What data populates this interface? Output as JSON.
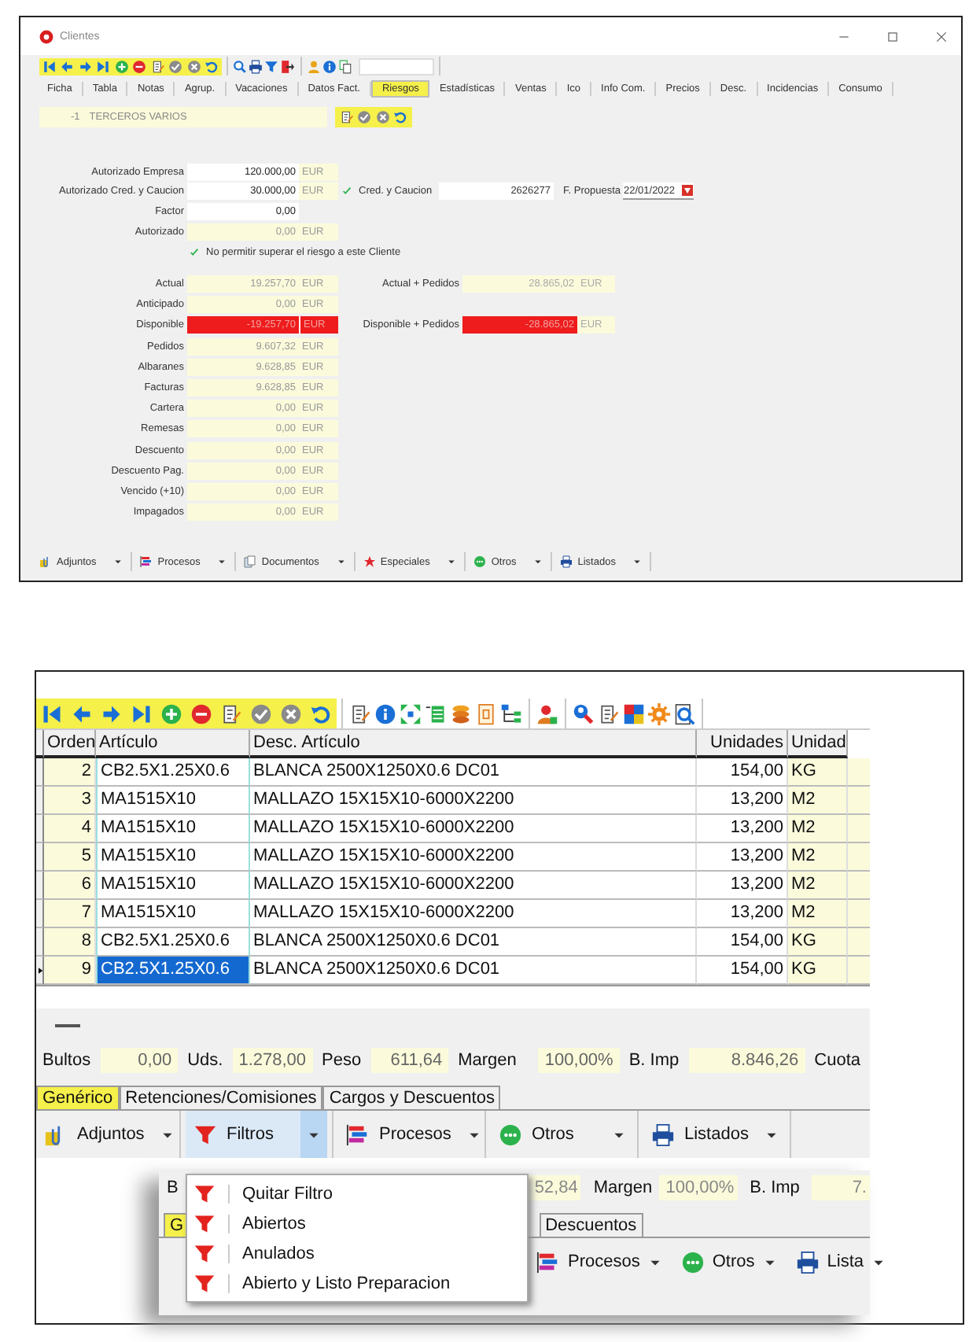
{
  "window": {
    "title": "Clientes"
  },
  "tabs": [
    {
      "label": "Ficha",
      "selected": false
    },
    {
      "label": "Tabla",
      "selected": false
    },
    {
      "label": "Notas",
      "selected": false
    },
    {
      "label": "Agrup.",
      "selected": false
    },
    {
      "label": "Vacaciones",
      "selected": false
    },
    {
      "label": "Datos Fact.",
      "selected": false
    },
    {
      "label": "Riesgos",
      "selected": true
    },
    {
      "label": "Estadísticas",
      "selected": false
    },
    {
      "label": "Ventas",
      "selected": false
    },
    {
      "label": "Ico",
      "selected": false
    },
    {
      "label": "Info Com.",
      "selected": false
    },
    {
      "label": "Precios",
      "selected": false
    },
    {
      "label": "Desc.",
      "selected": false
    },
    {
      "label": "Incidencias",
      "selected": false
    },
    {
      "label": "Consumo",
      "selected": false
    }
  ],
  "customer": {
    "code": "-1",
    "name": "TERCEROS VARIOS"
  },
  "limits": [
    {
      "label": "Autorizado Empresa",
      "value": "120.000,00",
      "unit": "EUR",
      "kind": "editable"
    },
    {
      "label": "Autorizado Cred. y Caucion",
      "value": "30.000,00",
      "unit": "EUR",
      "kind": "editable"
    },
    {
      "label": "Factor",
      "value": "0,00",
      "kind": "editable"
    },
    {
      "label": "Autorizado",
      "value": "0,00",
      "unit": "EUR",
      "kind": "readonly"
    }
  ],
  "credit_insurance": {
    "label": "Cred. y Caucion",
    "checked": true,
    "value": "2626277",
    "date_label": "F. Propuesta",
    "date": "22/01/2022"
  },
  "no_exceed": {
    "label": "No permitir superar el riesgo a este Cliente",
    "checked": true
  },
  "balances": [
    {
      "label": "Actual",
      "value": "19.257,70",
      "unit": "EUR",
      "kind": "readonly"
    },
    {
      "label": "Anticipado",
      "value": "0,00",
      "unit": "EUR",
      "kind": "readonly"
    },
    {
      "label": "Disponible",
      "value": "-19.257,70",
      "unit": "EUR",
      "kind": "alert"
    },
    {
      "label": "Pedidos",
      "value": "9.607,32",
      "unit": "EUR",
      "kind": "readonly"
    },
    {
      "label": "Albaranes",
      "value": "9.628,85",
      "unit": "EUR",
      "kind": "readonly"
    },
    {
      "label": "Facturas",
      "value": "9.628,85",
      "unit": "EUR",
      "kind": "readonly"
    },
    {
      "label": "Cartera",
      "value": "0,00",
      "unit": "EUR",
      "kind": "readonly"
    },
    {
      "label": "Remesas",
      "value": "0,00",
      "unit": "EUR",
      "kind": "readonly"
    },
    {
      "label": "Descuento",
      "value": "0,00",
      "unit": "EUR",
      "kind": "readonly"
    },
    {
      "label": "Descuento Pag.",
      "value": "0,00",
      "unit": "EUR",
      "kind": "readonly"
    },
    {
      "label": "Vencido (+10)",
      "value": "0,00",
      "unit": "EUR",
      "kind": "readonly"
    },
    {
      "label": "Impagados",
      "value": "0,00",
      "unit": "EUR",
      "kind": "readonly"
    }
  ],
  "balances_right": [
    {
      "label": "Actual + Pedidos",
      "value": "28.865,02",
      "unit": "EUR",
      "kind": "readonly"
    },
    {
      "label": "Disponible + Pedidos",
      "value": "-28.865,02",
      "unit": "EUR",
      "kind": "alert"
    }
  ],
  "window_actions": [
    {
      "label": "Adjuntos",
      "kind": "attachment"
    },
    {
      "label": "Procesos",
      "kind": "processes"
    },
    {
      "label": "Documentos",
      "kind": "documents"
    },
    {
      "label": "Especiales",
      "kind": "star"
    },
    {
      "label": "Otros",
      "kind": "dots"
    },
    {
      "label": "Listados",
      "kind": "printer"
    }
  ],
  "lines_panel": {
    "columns": [
      {
        "label": "Orden"
      },
      {
        "label": "Artículo"
      },
      {
        "label": "Desc. Artículo"
      },
      {
        "label": "Unidades"
      },
      {
        "label": "Unidad"
      }
    ],
    "rows": [
      {
        "cells": [
          "2",
          "CB2.5X1.25X0.6",
          "BLANCA 2500X1250X0.6 DC01",
          "154,00",
          "KG"
        ],
        "selected": false
      },
      {
        "cells": [
          "3",
          "MA1515X10",
          "MALLAZO 15X15X10-6000X2200",
          "13,200",
          "M2"
        ],
        "selected": false
      },
      {
        "cells": [
          "4",
          "MA1515X10",
          "MALLAZO 15X15X10-6000X2200",
          "13,200",
          "M2"
        ],
        "selected": false
      },
      {
        "cells": [
          "5",
          "MA1515X10",
          "MALLAZO 15X15X10-6000X2200",
          "13,200",
          "M2"
        ],
        "selected": false
      },
      {
        "cells": [
          "6",
          "MA1515X10",
          "MALLAZO 15X15X10-6000X2200",
          "13,200",
          "M2"
        ],
        "selected": false
      },
      {
        "cells": [
          "7",
          "MA1515X10",
          "MALLAZO 15X15X10-6000X2200",
          "13,200",
          "M2"
        ],
        "selected": false
      },
      {
        "cells": [
          "8",
          "CB2.5X1.25X0.6",
          "BLANCA 2500X1250X0.6 DC01",
          "154,00",
          "KG"
        ],
        "selected": false
      },
      {
        "cells": [
          "9",
          "CB2.5X1.25X0.6",
          "BLANCA 2500X1250X0.6 DC01",
          "154,00",
          "KG"
        ],
        "selected": true
      }
    ],
    "totals": [
      {
        "label": "Bultos",
        "value": "0,00"
      },
      {
        "label": "Uds.",
        "value": "1.278,00"
      },
      {
        "label": "Peso",
        "value": "611,64"
      },
      {
        "label": "Margen",
        "value": "100,00%"
      },
      {
        "label": "B. Imp",
        "value": "8.846,26"
      },
      {
        "label": "Cuota"
      }
    ],
    "subtabs": [
      {
        "label": "Genérico",
        "selected": true
      },
      {
        "label": "Retenciones/Comisiones",
        "selected": false
      },
      {
        "label": "Cargos y Descuentos",
        "selected": false
      }
    ],
    "actions": [
      {
        "label": "Adjuntos",
        "kind": "attachment",
        "open": false
      },
      {
        "label": "Filtros",
        "kind": "filter",
        "open": true
      },
      {
        "label": "Procesos",
        "kind": "processes",
        "open": false
      },
      {
        "label": "Otros",
        "kind": "dots",
        "open": false
      },
      {
        "label": "Listados",
        "kind": "printer",
        "open": false
      }
    ],
    "menu": [
      {
        "label": "Quitar Filtro"
      },
      {
        "label": "Abiertos"
      },
      {
        "label": "Anulados"
      },
      {
        "label": "Abierto y Listo Preparacion"
      }
    ],
    "background_window": {
      "summary": [
        {
          "kind": "label",
          "text": "B"
        },
        {
          "kind": "value",
          "text": "52,84"
        },
        {
          "kind": "label",
          "text": "Margen"
        },
        {
          "kind": "value",
          "text": "100,00%"
        },
        {
          "kind": "label",
          "text": "B. Imp"
        },
        {
          "kind": "value",
          "text": "7."
        }
      ],
      "tabs": [
        {
          "label": "G",
          "selected": true
        },
        {
          "label": "Descuentos",
          "selected": false
        }
      ],
      "actions": [
        {
          "label": "Procesos",
          "kind": "processes"
        },
        {
          "label": "Otros",
          "kind": "dots"
        },
        {
          "label": "Lista",
          "kind": "printer"
        }
      ]
    }
  }
}
